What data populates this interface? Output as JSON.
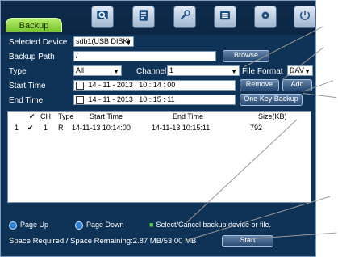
{
  "window": {
    "tab_label": "Backup"
  },
  "toolbar": {
    "icons": [
      {
        "name": "search-icon"
      },
      {
        "name": "file-icon"
      },
      {
        "name": "wrench-icon"
      },
      {
        "name": "list-icon"
      },
      {
        "name": "gear-icon"
      },
      {
        "name": "power-icon"
      }
    ]
  },
  "form": {
    "selected_device_label": "Selected Device",
    "selected_device_value": "sdb1(USB DISK)",
    "backup_path_label": "Backup Path",
    "backup_path_value": "/",
    "browse_label": "Browse",
    "type_label": "Type",
    "type_value": "All",
    "channel_label": "Channel",
    "channel_value": "1",
    "file_format_label": "File Format",
    "file_format_value": "DAV",
    "start_time_label": "Start Time",
    "start_time_value": "14 - 11 - 2013   |  10 :  14 :  00",
    "end_time_label": "End Time",
    "end_time_value": "14 - 11 - 2013   |  10 :  15 :  11",
    "remove_label": "Remove",
    "add_label": "Add",
    "one_key_backup_label": "One Key Backup"
  },
  "table": {
    "headers": [
      "",
      "✔",
      "CH",
      "Type",
      "Start Time",
      "End Time",
      "Size(KB)"
    ],
    "rows": [
      {
        "index": "1",
        "check": "✔",
        "ch": "1",
        "type": "R",
        "start": "14-11-13 10:14:00",
        "end": "14-11-13 10:15:11",
        "size": "792"
      }
    ]
  },
  "footer": {
    "page_up_label": "Page Up",
    "page_down_label": "Page Down",
    "select_cancel_label": "Select/Cancel backup device or file.",
    "space_label": "Space Required / Space Remaining:2.87 MB/53.00 MB",
    "start_label": "Start"
  }
}
